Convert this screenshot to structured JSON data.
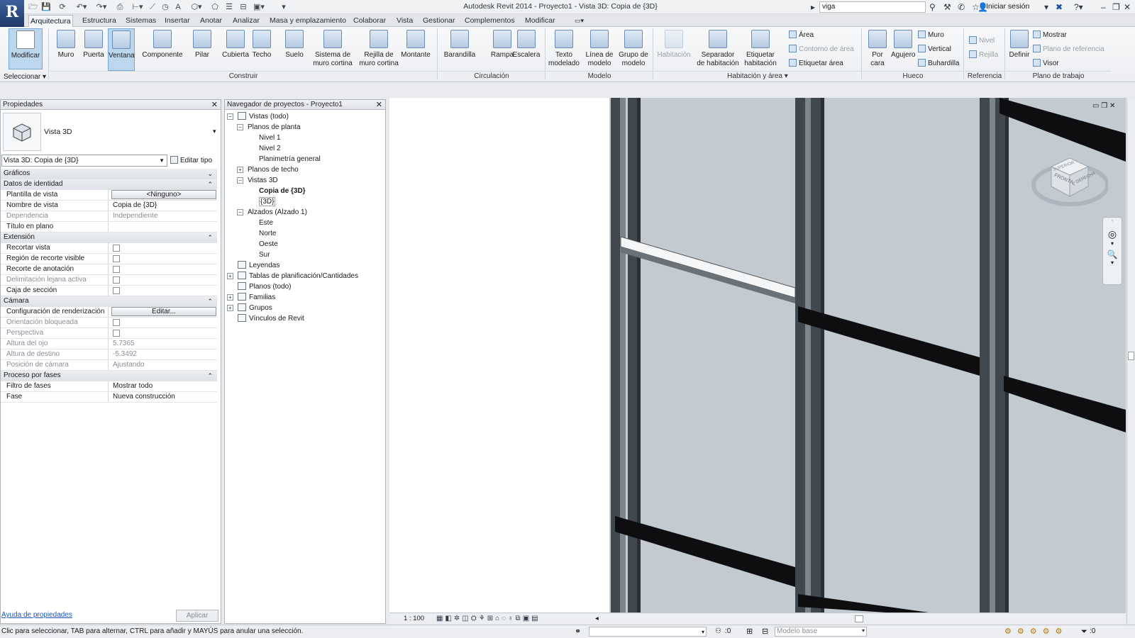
{
  "title": "Autodesk Revit 2014 -   Proyecto1 - Vista 3D: Copia de {3D}",
  "search": {
    "value": "viga"
  },
  "signin": "Iniciar sesión",
  "tabs": [
    "Arquitectura",
    "Estructura",
    "Sistemas",
    "Insertar",
    "Anotar",
    "Analizar",
    "Masa y emplazamiento",
    "Colaborar",
    "Vista",
    "Gestionar",
    "Complementos",
    "Modificar"
  ],
  "ribbon": {
    "modify": "Modificar",
    "select": "Seleccionar",
    "build": [
      "Muro",
      "Puerta",
      "Ventana",
      "Componente",
      "Pilar",
      "Cubierta",
      "Techo",
      "Suelo",
      "Sistema de\nmuro cortina",
      "Rejilla de\nmuro cortina",
      "Montante"
    ],
    "build_label": "Construir",
    "circ": [
      "Barandilla",
      "Rampa",
      "Escalera"
    ],
    "circ_label": "Circulación",
    "model": [
      "Texto\nmodelado",
      "Línea de\nmodelo",
      "Grupo de\nmodelo"
    ],
    "model_label": "Modelo",
    "room": [
      "Habitación",
      "Separador\nde habitación",
      "Etiquetar\nhabitación"
    ],
    "area_items": [
      "Área",
      "Contorno de área",
      "Etiquetar área"
    ],
    "room_label": "Habitación y área",
    "opening_big": [
      "Por\ncara",
      "Agujero"
    ],
    "opening_small": [
      "Muro",
      "Vertical",
      "Buhardilla"
    ],
    "opening_label": "Hueco",
    "ref_items": [
      "Nivel",
      "Rejilla"
    ],
    "ref_label": "Referencia",
    "wp_big": "Definir",
    "wp_small": [
      "Mostrar",
      "Plano de referencia",
      "Visor"
    ],
    "wp_label": "Plano de trabajo"
  },
  "properties": {
    "title": "Propiedades",
    "type_name": "Vista 3D",
    "selector": "Vista 3D: Copia de {3D}",
    "edit_type": "Editar tipo",
    "rows": [
      {
        "section": "Gráficos",
        "toggle": "¥"
      },
      {
        "section": "Datos de identidad",
        "toggle": "¤"
      },
      {
        "k": "Plantilla de vista",
        "btn": "<Ninguno>"
      },
      {
        "k": "Nombre de vista",
        "v": "Copia de {3D}"
      },
      {
        "k": "Dependencia",
        "v": "Independiente",
        "dis": true
      },
      {
        "k": "Título en plano",
        "v": ""
      },
      {
        "section": "Extensión",
        "toggle": "¤"
      },
      {
        "k": "Recortar vista",
        "cb": true
      },
      {
        "k": "Región de recorte visible",
        "cb": true
      },
      {
        "k": "Recorte de anotación",
        "cb": true
      },
      {
        "k": "Delimitación lejana activa",
        "cb": true,
        "dis": true
      },
      {
        "k": "Caja de sección",
        "cb": true
      },
      {
        "section": "Cámara",
        "toggle": "¤"
      },
      {
        "k": "Configuración de renderización",
        "btn": "Editar..."
      },
      {
        "k": "Orientación bloqueada",
        "cb": true,
        "dis": true
      },
      {
        "k": "Perspectiva",
        "cb": true,
        "dis": true
      },
      {
        "k": "Altura del ojo",
        "v": "5.7365",
        "dis": true
      },
      {
        "k": "Altura de destino",
        "v": "-5.3492",
        "dis": true
      },
      {
        "k": "Posición de cámara",
        "v": "Ajustando",
        "dis": true
      },
      {
        "section": "Proceso por fases",
        "toggle": "¤"
      },
      {
        "k": "Filtro de fases",
        "v": "Mostrar todo"
      },
      {
        "k": "Fase",
        "v": "Nueva construcción"
      }
    ],
    "help": "Ayuda de propiedades",
    "apply": "Aplicar"
  },
  "browser": {
    "title": "Navegador de proyectos - Proyecto1",
    "nodes": [
      {
        "t": "Vistas (todo)",
        "l": 0,
        "ex": "−",
        "icon": true
      },
      {
        "t": "Planos de planta",
        "l": 1,
        "ex": "−"
      },
      {
        "t": "Nivel 1",
        "l": 2
      },
      {
        "t": "Nivel 2",
        "l": 2
      },
      {
        "t": "Planimetría general",
        "l": 2
      },
      {
        "t": "Planos de techo",
        "l": 1,
        "ex": "+"
      },
      {
        "t": "Vistas 3D",
        "l": 1,
        "ex": "−"
      },
      {
        "t": "Copia de {3D}",
        "l": 2,
        "bold": true
      },
      {
        "t": "{3D}",
        "l": 2,
        "boxed": true
      },
      {
        "t": "Alzados (Alzado 1)",
        "l": 1,
        "ex": "−"
      },
      {
        "t": "Este",
        "l": 2
      },
      {
        "t": "Norte",
        "l": 2
      },
      {
        "t": "Oeste",
        "l": 2
      },
      {
        "t": "Sur",
        "l": 2
      },
      {
        "t": "Leyendas",
        "l": 0,
        "icon": true
      },
      {
        "t": "Tablas de planificación/Cantidades",
        "l": 0,
        "ex": "+",
        "icon": true
      },
      {
        "t": "Planos (todo)",
        "l": 0,
        "icon": true
      },
      {
        "t": "Familias",
        "l": 0,
        "ex": "+",
        "icon": true
      },
      {
        "t": "Grupos",
        "l": 0,
        "ex": "+",
        "icon": true
      },
      {
        "t": "Vínculos de Revit",
        "l": 0,
        "icon": true
      }
    ]
  },
  "viewcube": {
    "face_front": "FRONTAL",
    "face_top": "SUPERIOR",
    "face_right": "DERECHA"
  },
  "view": {
    "scale": "1 : 100"
  },
  "status": {
    "message": "Clic para seleccionar, TAB para alternar, CTRL para añadir y MAYÚS para anular una selección.",
    "count": ":0",
    "model": "Modelo base",
    "filter_count": ":0"
  }
}
